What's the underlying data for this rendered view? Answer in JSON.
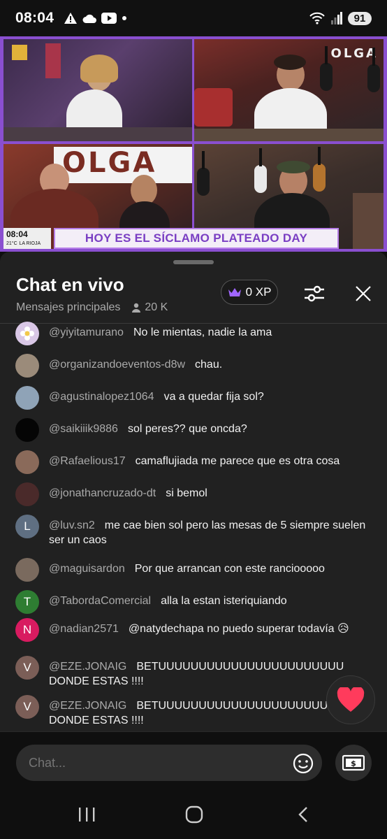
{
  "status_bar": {
    "time": "08:04",
    "battery": "91"
  },
  "video": {
    "brand": "OLGA",
    "banner": "HOY ES EL SÍCLAMO PLATEADO DAY",
    "clock_time": "08:04",
    "clock_temp": "21°C",
    "clock_city": "LA RIOJA"
  },
  "chat": {
    "title": "Chat en vivo",
    "subtitle": "Mensajes principales",
    "viewers": "20 K",
    "xp": "0 XP",
    "input_placeholder": "Chat...",
    "messages": [
      {
        "author": "@yiyitamurano",
        "text": "No le mientas, nadie la ama",
        "avatar_letter": "",
        "avatar_color": "#d9c7e6"
      },
      {
        "author": "@organizandoeventos-d8w",
        "text": "chau.",
        "avatar_letter": "",
        "avatar_color": "#9b8b7a"
      },
      {
        "author": "@agustinalopez1064",
        "text": "va a quedar fija sol?",
        "avatar_letter": "",
        "avatar_color": "#8fa3b7"
      },
      {
        "author": "@saikiiik9886",
        "text": "sol peres?? que oncda?",
        "avatar_letter": "",
        "avatar_color": "#050505"
      },
      {
        "author": "@Rafaelious17",
        "text": "camaflujiada me parece que es otra cosa",
        "avatar_letter": "",
        "avatar_color": "#8a6a5a"
      },
      {
        "author": "@jonathancruzado-dt",
        "text": "si bemol",
        "avatar_letter": "",
        "avatar_color": "#4a2a2a"
      },
      {
        "author": "@luv.sn2",
        "text": "me cae bien sol pero las mesas de 5 siempre suelen ser un caos",
        "avatar_letter": "L",
        "avatar_color": "#5f6f82"
      },
      {
        "author": "@maguisardon",
        "text": "Por que arrancan con este ranciooooo",
        "avatar_letter": "",
        "avatar_color": "#7a6a5e"
      },
      {
        "author": "@TabordaComercial",
        "text": "alla la estan isteriquiando",
        "avatar_letter": "T",
        "avatar_color": "#2e7d32"
      },
      {
        "author": "@nadian2571",
        "text": "@natydechapa no puedo superar todavía 😥",
        "avatar_letter": "N",
        "avatar_color": "#d81b60"
      },
      {
        "author": "@EZE.JONAIG",
        "text": "BETUUUUUUUUUUUUUUUUUUUUUUU DONDE ESTAS !!!!",
        "avatar_letter": "V",
        "avatar_color": "#7b5e57"
      },
      {
        "author": "@EZE.JONAIG",
        "text": "BETUUUUUUUUUUUUUUUUUUUUUUU DONDE ESTAS !!!!",
        "avatar_letter": "V",
        "avatar_color": "#7b5e57"
      }
    ]
  },
  "icons": {
    "status": [
      "warning-icon",
      "cloud-icon",
      "youtube-icon",
      "dot-icon",
      "wifi-icon",
      "signal-icon"
    ],
    "header": [
      "crown-icon",
      "sliders-icon",
      "close-icon",
      "person-icon"
    ],
    "input": [
      "smiley-icon",
      "super-chat-icon",
      "heart-icon"
    ],
    "nav": [
      "recents-icon",
      "home-icon",
      "back-icon"
    ]
  },
  "colors": {
    "accent": "#8a4fd0",
    "heart": "#ff3b5c",
    "crown": "#a066ff"
  }
}
